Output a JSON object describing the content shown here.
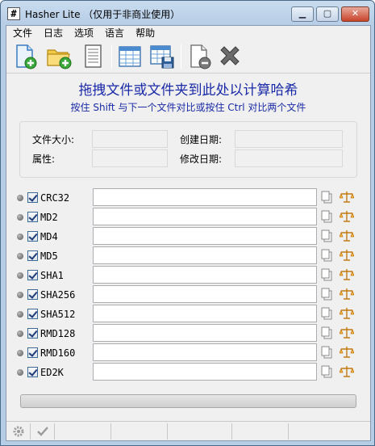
{
  "window": {
    "app_icon": "#",
    "title": "Hasher Lite （仅用于非商业使用）",
    "minimize_label": "▁",
    "maximize_label": "▢",
    "close_label": "✕"
  },
  "menu": [
    "文件",
    "日志",
    "选项",
    "语言",
    "帮助"
  ],
  "toolbar": {
    "buttons": [
      "add-file-icon",
      "add-folder-icon",
      "document-icon",
      "table-icon",
      "save-table-icon",
      "remove-file-icon",
      "clear-icon"
    ]
  },
  "drop_zone": {
    "title": "拖拽文件或文件夹到此处以计算哈希",
    "subtitle": "按住 Shift 与下一个文件对比或按住 Ctrl 对比两个文件"
  },
  "file_info": {
    "size_label": "文件大小:",
    "created_label": "创建日期:",
    "attributes_label": "属性:",
    "modified_label": "修改日期:",
    "size_value": "",
    "created_value": "",
    "attributes_value": "",
    "modified_value": ""
  },
  "hashes": [
    {
      "name": "CRC32",
      "checked": true,
      "value": ""
    },
    {
      "name": "MD2",
      "checked": true,
      "value": ""
    },
    {
      "name": "MD4",
      "checked": true,
      "value": ""
    },
    {
      "name": "MD5",
      "checked": true,
      "value": ""
    },
    {
      "name": "SHA1",
      "checked": true,
      "value": ""
    },
    {
      "name": "SHA256",
      "checked": true,
      "value": ""
    },
    {
      "name": "SHA512",
      "checked": true,
      "value": ""
    },
    {
      "name": "RMD128",
      "checked": true,
      "value": ""
    },
    {
      "name": "RMD160",
      "checked": true,
      "value": ""
    },
    {
      "name": "ED2K",
      "checked": true,
      "value": ""
    }
  ],
  "progress": {
    "value": 0
  },
  "status": {
    "icons": [
      "settings-icon",
      "check-icon"
    ]
  },
  "colors": {
    "accent_text": "#1a2aa8",
    "title_gradient": "#b6cde6"
  }
}
